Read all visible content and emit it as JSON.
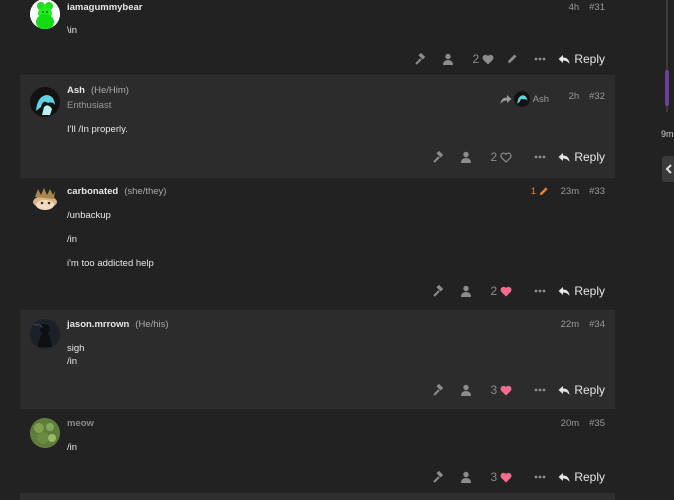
{
  "posts": [
    {
      "id": "31",
      "username": "iamagummybear",
      "time": "4h",
      "number": "#31",
      "body": [
        "\\in"
      ],
      "likes": "2",
      "reply_label": "Reply"
    },
    {
      "id": "32",
      "username": "Ash",
      "pronouns": "(He/Him)",
      "user_title": "Enthusiast",
      "reply_to_user": "Ash",
      "time": "2h",
      "number": "#32",
      "body": [
        "I'll /In properly."
      ],
      "likes": "2",
      "reply_label": "Reply"
    },
    {
      "id": "33",
      "username": "carbonated",
      "pronouns": "(she/they)",
      "edit_count": "1",
      "time": "23m",
      "number": "#33",
      "body": [
        "/unbackup",
        "/in",
        "i'm too addicted help"
      ],
      "likes": "2",
      "reply_label": "Reply"
    },
    {
      "id": "34",
      "username": "jason.mrrown",
      "pronouns": "(He/his)",
      "time": "22m",
      "number": "#34",
      "body": [
        "sigh",
        "/in"
      ],
      "likes": "3",
      "reply_label": "Reply"
    },
    {
      "id": "35",
      "username": "meow",
      "time": "20m",
      "number": "#35",
      "body": [
        "/in"
      ],
      "likes": "3",
      "reply_label": "Reply"
    }
  ],
  "timeline": {
    "label": "9m"
  },
  "colors": {
    "background": "#222222",
    "post_alt": "#2c2c2c",
    "liked_heart": "#fa6c8d",
    "edit_orange": "#e0822d",
    "timeline_accent": "#6b3fa0"
  }
}
